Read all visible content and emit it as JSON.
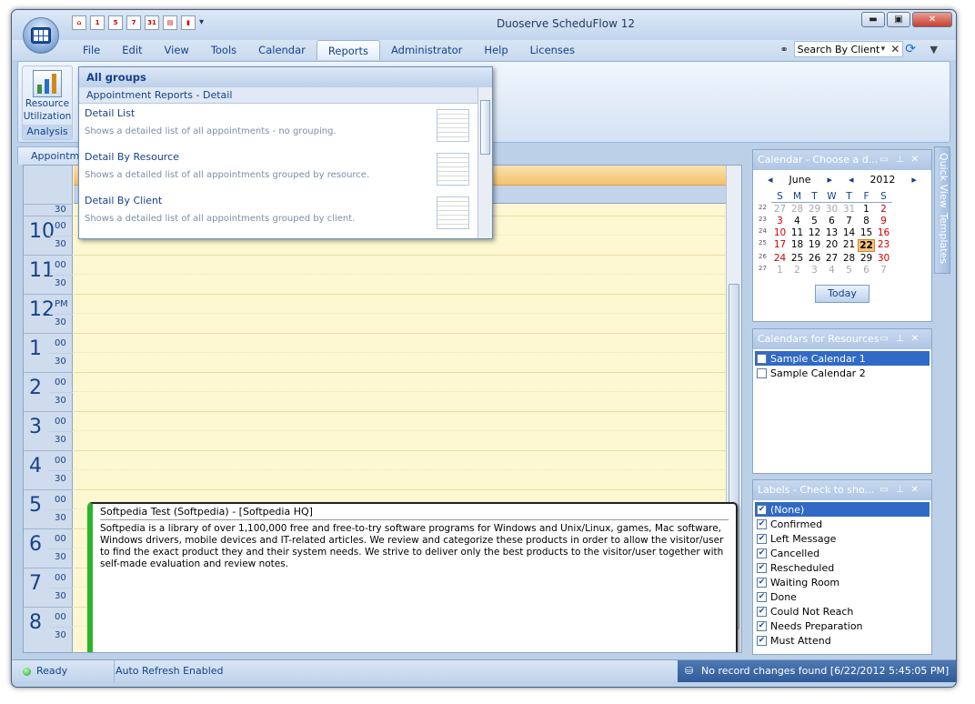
{
  "window": {
    "title": "Duoserve ScheduFlow 12",
    "minimize": "▬",
    "maximize": "▣",
    "close": "✕"
  },
  "qat": {
    "cal1": "1",
    "cal5": "5",
    "cal7": "7",
    "cal31": "31",
    "more": "▾"
  },
  "menu": {
    "file": "File",
    "edit": "Edit",
    "view": "View",
    "tools": "Tools",
    "calendar": "Calendar",
    "reports": "Reports",
    "administrator": "Administrator",
    "help": "Help",
    "licenses": "Licenses"
  },
  "search": {
    "label": "Search By Client",
    "clear": "✕",
    "refresh": "⟳",
    "filter": "▼"
  },
  "ribbon": {
    "resource_line1": "Resource",
    "resource_line2": "Utilization",
    "group_label": "Analysis"
  },
  "tab": {
    "label": "Appointmer"
  },
  "dropdown": {
    "header": "All groups",
    "section": "Appointment Reports - Detail",
    "items": [
      {
        "title": "Detail List",
        "desc": "Shows a detailed list of all appointments - no grouping."
      },
      {
        "title": "Detail By Resource",
        "desc": "Shows a detailed list of all appointments grouped by resource."
      },
      {
        "title": "Detail By Client",
        "desc": "Shows a detailed list of all appointments grouped by client."
      }
    ]
  },
  "ruler": {
    "top_half": "30",
    "slots": [
      {
        "hour": "10",
        "min": "00",
        "half": "30"
      },
      {
        "hour": "11",
        "min": "00",
        "half": "30"
      },
      {
        "hour": "12",
        "min": "PM",
        "half": "30"
      },
      {
        "hour": "1",
        "min": "00",
        "half": "30"
      },
      {
        "hour": "2",
        "min": "00",
        "half": "30"
      },
      {
        "hour": "3",
        "min": "00",
        "half": "30"
      },
      {
        "hour": "4",
        "min": "00",
        "half": "30"
      },
      {
        "hour": "5",
        "min": "00",
        "half": "30"
      },
      {
        "hour": "6",
        "min": "00",
        "half": "30"
      },
      {
        "hour": "7",
        "min": "00",
        "half": "30"
      },
      {
        "hour": "8",
        "min": "00",
        "half": "30"
      }
    ]
  },
  "appointment": {
    "title": "Softpedia Test (Softpedia) - [Softpedia HQ]",
    "body": "Softpedia is a library of over 1,100,000 free and free-to-try software programs for Windows and Unix/Linux, games, Mac software, Windows drivers, mobile devices and IT-related articles. We review and categorize these products in order to allow the visitor/user to find the exact product they and their system needs. We strive to deliver only the best products to the visitor/user together with self-made evaluation and review notes.",
    "accent": "#2ab52a"
  },
  "calendar_panel": {
    "title": "Calendar - Choose a d...",
    "month": "June",
    "year": "2012",
    "day_names": [
      "S",
      "M",
      "T",
      "W",
      "T",
      "F",
      "S"
    ],
    "weeks": [
      {
        "wk": "22",
        "days": [
          "27",
          "28",
          "29",
          "30",
          "31",
          "1",
          "2"
        ]
      },
      {
        "wk": "23",
        "days": [
          "3",
          "4",
          "5",
          "6",
          "7",
          "8",
          "9"
        ]
      },
      {
        "wk": "24",
        "days": [
          "10",
          "11",
          "12",
          "13",
          "14",
          "15",
          "16"
        ]
      },
      {
        "wk": "25",
        "days": [
          "17",
          "18",
          "19",
          "20",
          "21",
          "22",
          "23"
        ]
      },
      {
        "wk": "26",
        "days": [
          "24",
          "25",
          "26",
          "27",
          "28",
          "29",
          "30"
        ]
      },
      {
        "wk": "27",
        "days": [
          "1",
          "2",
          "3",
          "4",
          "5",
          "6",
          "7"
        ]
      }
    ],
    "today_label": "Today"
  },
  "resources_panel": {
    "title": "Calendars for Resources",
    "items": [
      {
        "label": "Sample Calendar 1",
        "checked": false
      },
      {
        "label": "Sample Calendar 2",
        "checked": false
      }
    ]
  },
  "labels_panel": {
    "title": "Labels - Check to sho...",
    "items": [
      "(None)",
      "Confirmed",
      "Left Message",
      "Cancelled",
      "Rescheduled",
      "Waiting Room",
      "Done",
      "Could Not Reach",
      "Needs Preparation",
      "Must Attend"
    ]
  },
  "panel_buttons": {
    "menu": "▭",
    "pin": "⊥",
    "close": "✕"
  },
  "sidebar": {
    "quick_view": "Quick View",
    "templates": "Templates"
  },
  "status": {
    "ready": "Ready",
    "auto_refresh": "Auto Refresh Enabled",
    "record": "No record changes found [6/22/2012 5:45:05 PM]"
  }
}
